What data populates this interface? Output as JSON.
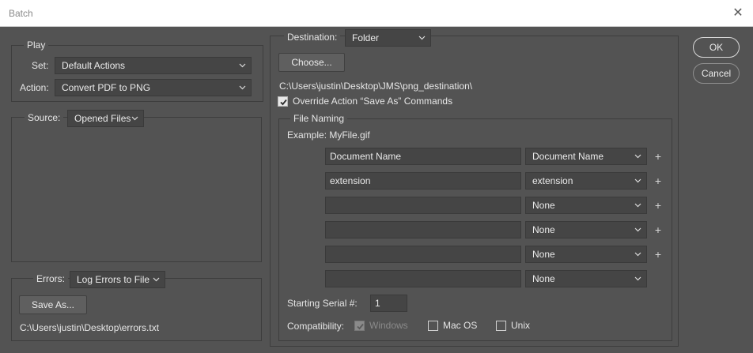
{
  "window": {
    "title": "Batch",
    "close_icon": "close-icon"
  },
  "play": {
    "legend": "Play",
    "set_label": "Set:",
    "set_value": "Default Actions",
    "action_label": "Action:",
    "action_value": "Convert PDF to PNG"
  },
  "source": {
    "label": "Source:",
    "value": "Opened Files"
  },
  "errors": {
    "label": "Errors:",
    "value": "Log Errors to File",
    "save_as_label": "Save As...",
    "path": "C:\\Users\\justin\\Desktop\\errors.txt"
  },
  "destination": {
    "label": "Destination:",
    "value": "Folder",
    "choose_label": "Choose...",
    "path": "C:\\Users\\justin\\Desktop\\JMS\\png_destination\\",
    "override_label": "Override Action “Save As” Commands",
    "override_checked": true
  },
  "file_naming": {
    "legend": "File Naming",
    "example": "Example: MyFile.gif",
    "rows": [
      {
        "text": "Document Name",
        "select": "Document Name",
        "plus": "+"
      },
      {
        "text": "extension",
        "select": "extension",
        "plus": "+"
      },
      {
        "text": "",
        "select": "None",
        "plus": "+"
      },
      {
        "text": "",
        "select": "None",
        "plus": "+"
      },
      {
        "text": "",
        "select": "None",
        "plus": "+"
      },
      {
        "text": "",
        "select": "None",
        "plus": ""
      }
    ]
  },
  "serial": {
    "label": "Starting Serial #:",
    "value": "1"
  },
  "compatibility": {
    "label": "Compatibility:",
    "windows": "Windows",
    "mac": "Mac OS",
    "unix": "Unix"
  },
  "buttons": {
    "ok": "OK",
    "cancel": "Cancel"
  },
  "colors": {
    "panel": "#535353",
    "field": "#454545",
    "border": "#3d3d3d",
    "text": "#e6e6e6"
  }
}
